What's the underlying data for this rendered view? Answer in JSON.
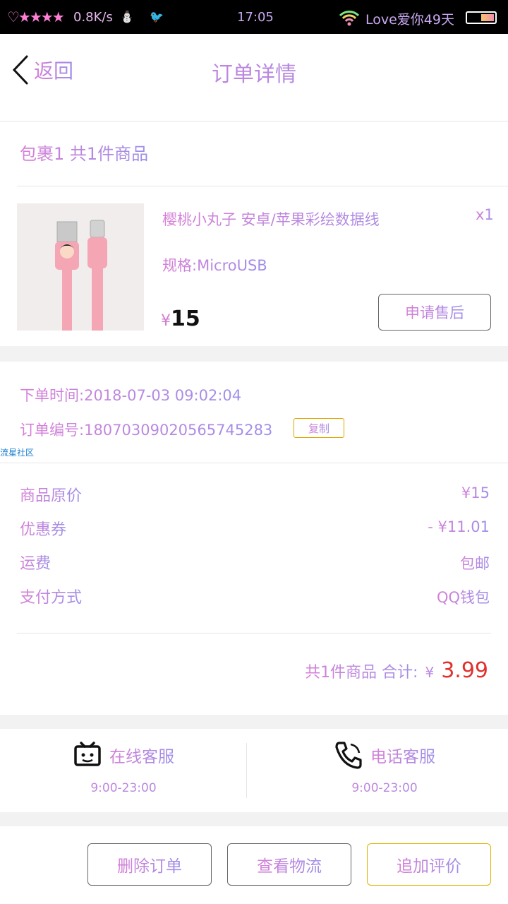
{
  "status_bar": {
    "decor": "♡★★★★",
    "speed": "0.8K/s",
    "emoji_left": "⛄",
    "emoji_right": "🐦",
    "time": "17:05",
    "carrier": "Love爱你49天",
    "battery_colors": [
      "#f7c36a",
      "#f08fb0"
    ]
  },
  "header": {
    "back_label": "返回",
    "title": "订单详情"
  },
  "package": {
    "label": "包裹1 共1件商品"
  },
  "product": {
    "name": "樱桃小丸子 安卓/苹果彩绘数据线",
    "spec": "规格:MicroUSB",
    "qty": "x1",
    "currency": "¥",
    "price": "15",
    "after_sale_label": "申请售后",
    "image_icon": "pink-usb-cable-image"
  },
  "order_info": {
    "time_label": "下单时间:",
    "time_value": "2018-07-03 09:02:04",
    "number_label": "订单编号:",
    "number_value": "1807030902056574528​3",
    "copy_label": "复制",
    "watermark": "流星社区"
  },
  "price_rows": [
    {
      "label": "商品原价",
      "value": "¥15"
    },
    {
      "label": "优惠券",
      "value": "- ¥11.01"
    },
    {
      "label": "运费",
      "value": "包邮"
    },
    {
      "label": "支付方式",
      "value": "QQ钱包"
    }
  ],
  "total": {
    "summary": "共1件商品  合计:",
    "currency": "¥",
    "amount": "3.99"
  },
  "services": {
    "online": {
      "title": "在线客服",
      "hours": "9:00-23:00",
      "icon": "chat-bubble-icon"
    },
    "phone": {
      "title": "电话客服",
      "hours": "9:00-23:00",
      "icon": "phone-icon"
    }
  },
  "actions": {
    "delete": "删除订单",
    "logistics": "查看物流",
    "review": "追加评价"
  },
  "colors": {
    "accent_gradient": [
      "#d77fd7",
      "#9e8fe8"
    ],
    "total_red": "#e0312d",
    "primary_border": "#e0b400"
  }
}
